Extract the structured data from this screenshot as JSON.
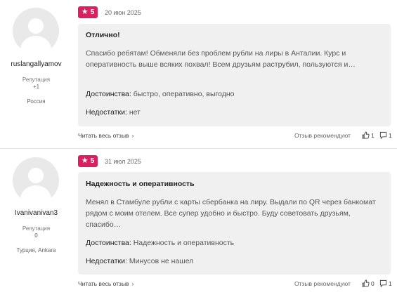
{
  "reviews": [
    {
      "author": {
        "username": "ruslangallyamov",
        "reputation_label": "Репутация",
        "reputation_value": "+1",
        "location": "Россия"
      },
      "rating": "5",
      "date": "20 июн 2025",
      "title": "Отлично!",
      "text": "Спасибо ребятам! Обменяли без проблем рубли на лиры в Анталии. Курс и оперативность выше всяких похвал! Всем друзьям раструбил, пользуются и…",
      "pros_label": "Достоинства:",
      "pros": "быстро, оперативно, выгодно",
      "cons_label": "Недостатки:",
      "cons": "нет",
      "read_more": "Читать весь отзыв",
      "recommend": "Отзыв рекомендуют",
      "likes": "1",
      "comments": "1"
    },
    {
      "author": {
        "username": "Ivanivanivan3",
        "reputation_label": "Репутация",
        "reputation_value": "0",
        "location": "Турция, Ankara"
      },
      "rating": "5",
      "date": "31 июл 2025",
      "title": "Надежность и оперативность",
      "text": "Менял в Стамбуле рубли с карты сбербанка на лиру. Выдали по QR через банкомат рядом с моим отелем. Все супер удобно и быстро. Буду советовать друзьям, спасибо…",
      "pros_label": "Достоинства:",
      "pros": "Надежность и оперативность",
      "cons_label": "Недостатки:",
      "cons": "Минусов не нашел",
      "read_more": "Читать весь отзыв",
      "recommend": "Отзыв рекомендуют",
      "likes": "0",
      "comments": "1"
    }
  ],
  "colors": {
    "badge": "#d9215f",
    "card_bg": "#f0f0f0",
    "positive_rep": "#2e8b2e"
  },
  "icons": [
    "user-avatar-placeholder",
    "star-icon",
    "chevron-right-icon",
    "thumbs-up-icon",
    "comment-icon"
  ]
}
